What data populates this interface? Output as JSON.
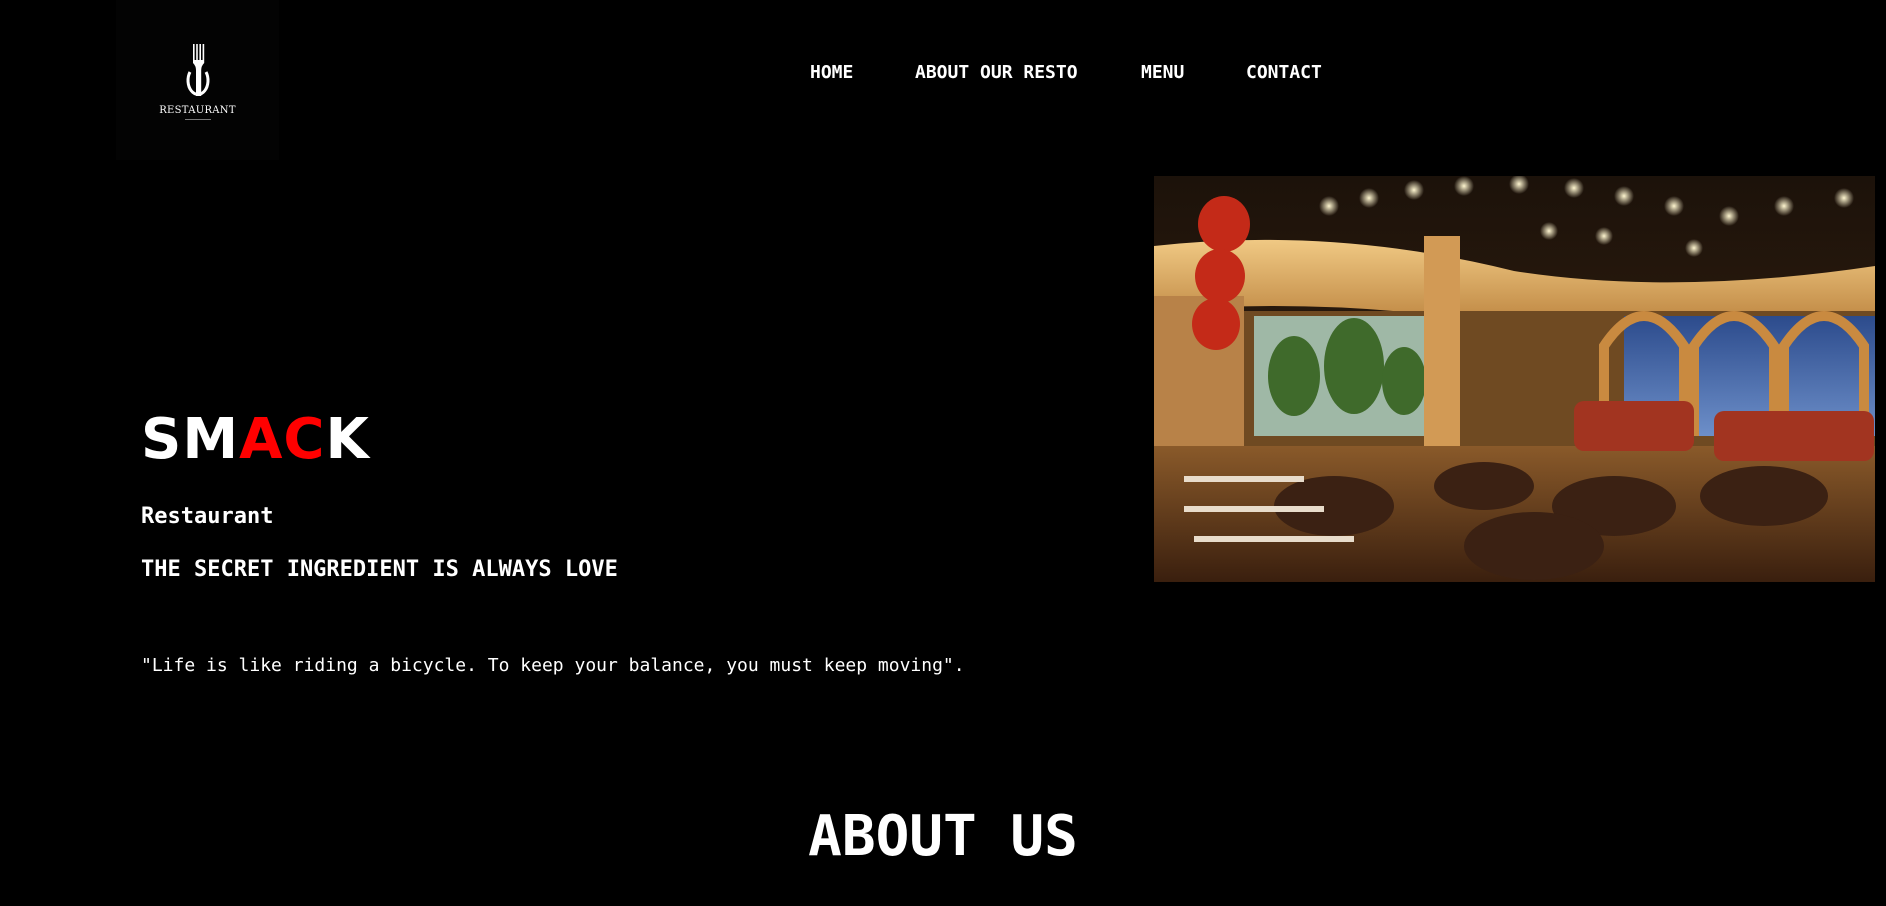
{
  "logo": {
    "text": "RESTAURANT",
    "icon": "fork-knife-icon"
  },
  "nav": {
    "items": [
      {
        "label": "HOME"
      },
      {
        "label": "ABOUT OUR RESTO"
      },
      {
        "label": "MENU"
      },
      {
        "label": "CONTACT"
      }
    ]
  },
  "hero": {
    "brand_part1": "SM",
    "brand_accent": "AC",
    "brand_part2": "K",
    "subtitle": "Restaurant",
    "tagline": "THE SECRET INGREDIENT IS ALWAYS LOVE",
    "quote": "\"Life is like riding a bicycle. To keep your balance, you must keep moving\"."
  },
  "about": {
    "title": "ABOUT US"
  },
  "colors": {
    "background": "#000000",
    "text": "#ffffff",
    "accent": "#ff0000"
  }
}
